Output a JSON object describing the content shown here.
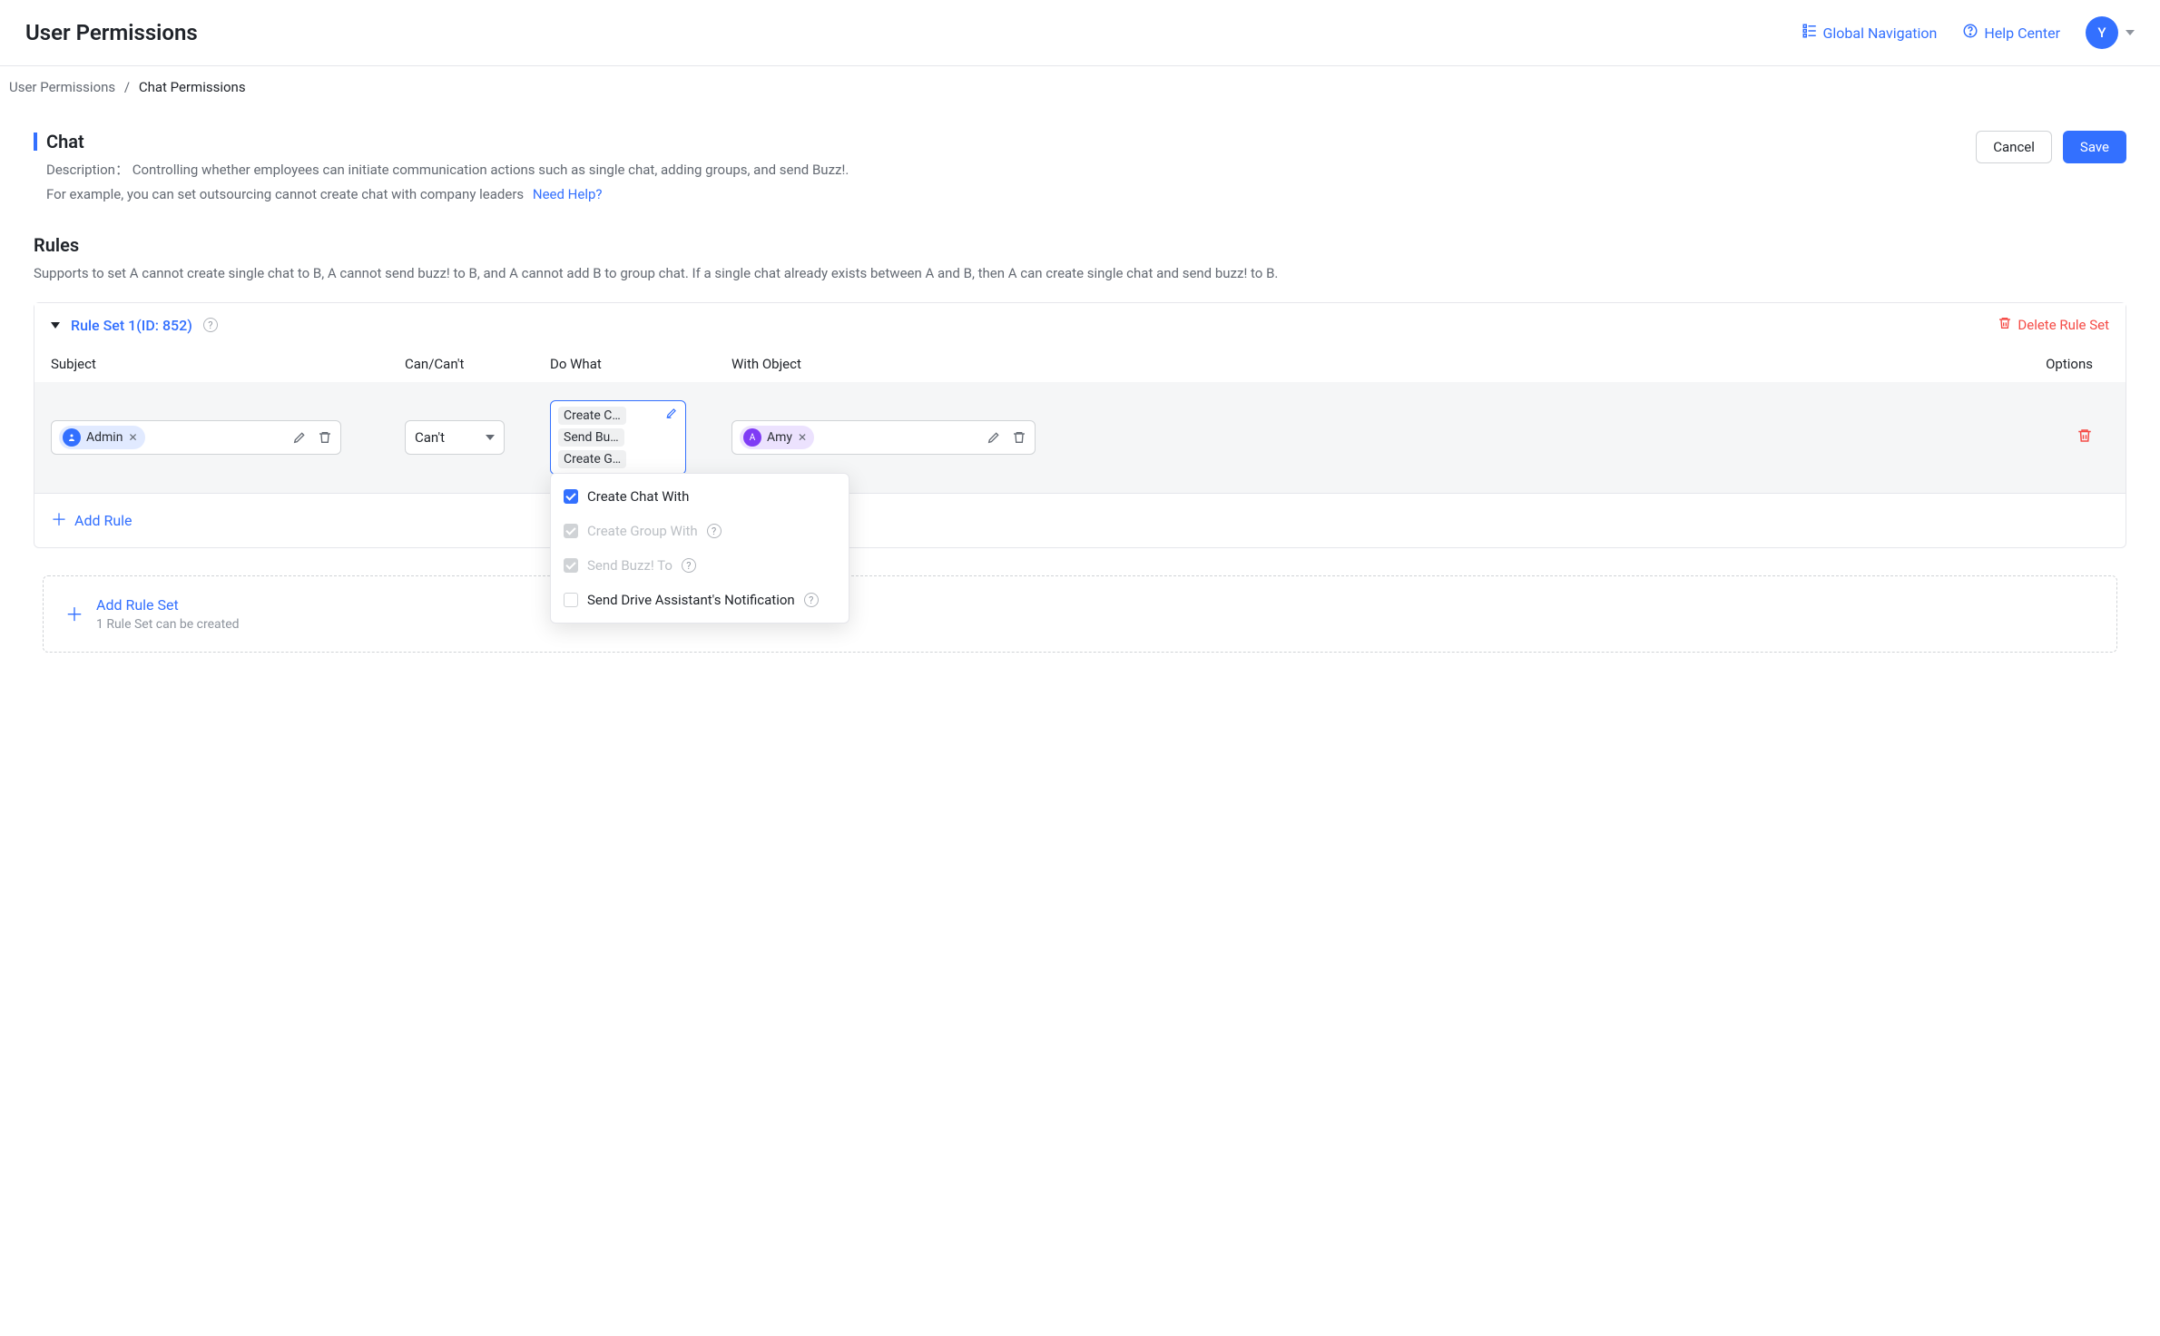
{
  "header": {
    "title": "User Permissions",
    "global_nav": "Global Navigation",
    "help_center": "Help Center",
    "avatar_initial": "Y"
  },
  "breadcrumb": {
    "root": "User Permissions",
    "current": "Chat Permissions",
    "separator": "/"
  },
  "chat": {
    "title": "Chat",
    "desc_label": "Description：",
    "desc_line1": "Controlling whether employees can initiate communication actions such as single chat, adding groups, and send Buzz!.",
    "desc_line2": "For example, you can set outsourcing cannot create chat with company leaders",
    "need_help": "Need Help?",
    "cancel": "Cancel",
    "save": "Save"
  },
  "rules": {
    "title": "Rules",
    "desc": "Supports to set A cannot create single chat to B, A cannot send buzz! to B, and A cannot add B to group chat. If a single chat already exists between A and B, then A can create single chat and send buzz! to B."
  },
  "ruleset": {
    "name": "Rule Set 1(ID: 852)",
    "delete": "Delete Rule Set",
    "columns": {
      "subject": "Subject",
      "can": "Can/Can't",
      "dowhat": "Do What",
      "withobj": "With Object",
      "options": "Options"
    },
    "row": {
      "subject_tag": "Admin",
      "can_value": "Can't",
      "dowhat_chips": [
        "Create C…",
        "Send Bu…",
        "Create G…"
      ],
      "with_tag": "Amy",
      "with_initial": "A"
    },
    "dropdown": {
      "create_chat": "Create Chat With",
      "create_group": "Create Group With",
      "send_buzz": "Send Buzz! To",
      "send_drive": "Send Drive Assistant's Notification"
    },
    "add_rule": "Add Rule"
  },
  "add_ruleset": {
    "title": "Add Rule Set",
    "sub": "1 Rule Set can be created"
  }
}
